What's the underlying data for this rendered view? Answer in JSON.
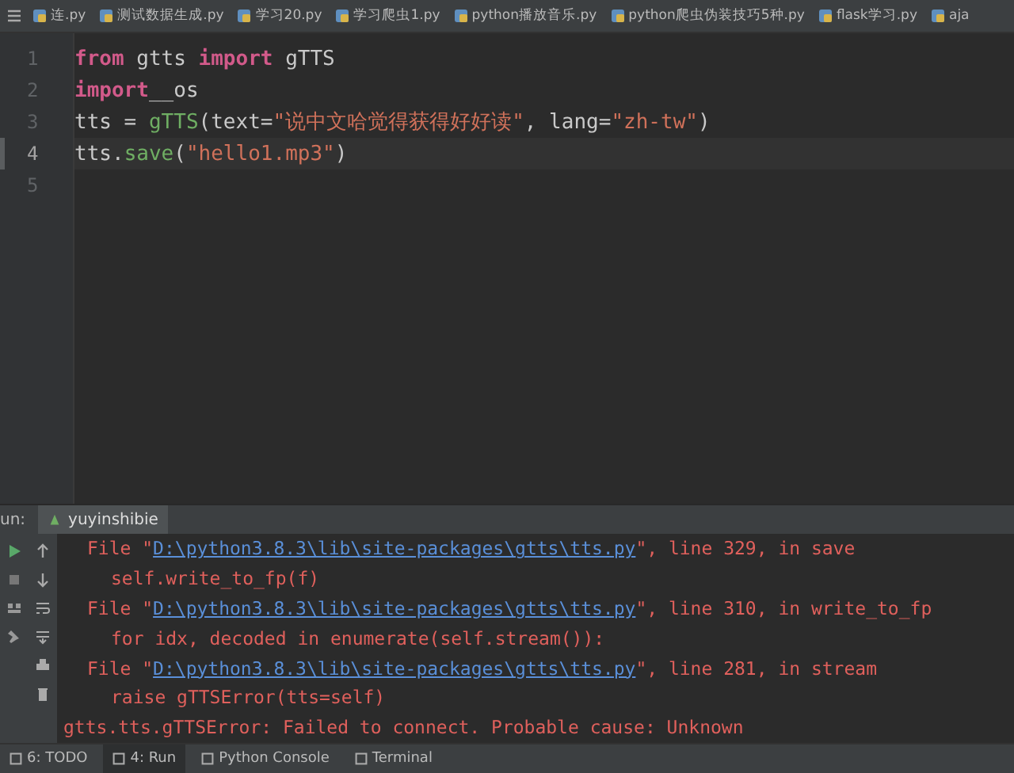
{
  "editor_tabs": [
    {
      "label": "连.py",
      "selected": false
    },
    {
      "label": "测试数据生成.py",
      "selected": false
    },
    {
      "label": "学习20.py",
      "selected": false
    },
    {
      "label": "学习爬虫1.py",
      "selected": false
    },
    {
      "label": "python播放音乐.py",
      "selected": false
    },
    {
      "label": "python爬虫伪装技巧5种.py",
      "selected": false
    },
    {
      "label": "flask学习.py",
      "selected": false
    },
    {
      "label": "aja",
      "selected": false
    }
  ],
  "editor": {
    "lines": [
      {
        "number": "1",
        "current": false,
        "tokens": [
          {
            "kind": "keyword",
            "text": "from"
          },
          {
            "kind": "plain",
            "text": " gtts "
          },
          {
            "kind": "keyword",
            "text": "import"
          },
          {
            "kind": "plain",
            "text": " gTTS"
          }
        ]
      },
      {
        "number": "2",
        "current": false,
        "tokens": [
          {
            "kind": "keyword",
            "text": "import"
          },
          {
            "kind": "plain",
            "text": "__os"
          }
        ]
      },
      {
        "number": "3",
        "current": false,
        "tokens": [
          {
            "kind": "plain",
            "text": "tts = "
          },
          {
            "kind": "function",
            "text": "gTTS"
          },
          {
            "kind": "plain",
            "text": "(text="
          },
          {
            "kind": "string",
            "text": "\"说中文哈觉得获得好好读\""
          },
          {
            "kind": "plain",
            "text": ", lang="
          },
          {
            "kind": "string",
            "text": "\"zh-tw\""
          },
          {
            "kind": "plain",
            "text": ")"
          }
        ]
      },
      {
        "number": "4",
        "current": true,
        "tokens": [
          {
            "kind": "plain",
            "text": "tts."
          },
          {
            "kind": "function",
            "text": "save"
          },
          {
            "kind": "plain",
            "text": "("
          },
          {
            "kind": "string",
            "text": "\"hello1.mp3\""
          },
          {
            "kind": "plain",
            "text": ")"
          }
        ]
      },
      {
        "number": "5",
        "current": false
      }
    ]
  },
  "run_panel": {
    "label": "un:",
    "config": "yuyinshibie",
    "lines": [
      {
        "kind": "frame",
        "parts": [
          {
            "kind": "error",
            "text": "File \""
          },
          {
            "kind": "link",
            "text": "D:\\python3.8.3\\lib\\site-packages\\gtts\\tts.py"
          },
          {
            "kind": "error",
            "text": "\", line 329, in save"
          }
        ]
      },
      {
        "kind": "source",
        "parts": [
          {
            "kind": "error",
            "text": "self.write_to_fp(f)"
          }
        ]
      },
      {
        "kind": "frame",
        "parts": [
          {
            "kind": "error",
            "text": "File \""
          },
          {
            "kind": "link",
            "text": "D:\\python3.8.3\\lib\\site-packages\\gtts\\tts.py"
          },
          {
            "kind": "error",
            "text": "\", line 310, in write_to_fp"
          }
        ]
      },
      {
        "kind": "source",
        "parts": [
          {
            "kind": "error",
            "text": "for idx, decoded in enumerate(self.stream()):"
          }
        ]
      },
      {
        "kind": "frame",
        "parts": [
          {
            "kind": "error",
            "text": "File \""
          },
          {
            "kind": "link",
            "text": "D:\\python3.8.3\\lib\\site-packages\\gtts\\tts.py"
          },
          {
            "kind": "error",
            "text": "\", line 281, in stream"
          }
        ]
      },
      {
        "kind": "source",
        "parts": [
          {
            "kind": "error",
            "text": "raise gTTSError(tts=self)"
          }
        ]
      },
      {
        "kind": "exception",
        "parts": [
          {
            "kind": "error",
            "text": "gtts.tts.gTTSError: Failed to connect. Probable cause: Unknown"
          }
        ]
      }
    ]
  },
  "status_bar": [
    {
      "label": "6: TODO",
      "selected": false
    },
    {
      "label": "4: Run",
      "selected": true
    },
    {
      "label": "Python Console",
      "selected": false
    },
    {
      "label": "Terminal",
      "selected": false
    }
  ]
}
